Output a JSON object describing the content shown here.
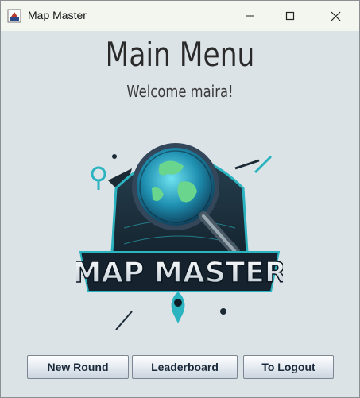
{
  "window": {
    "title": "Map Master",
    "icon": "java-app-icon",
    "controls": [
      "minimize-icon",
      "maximize-icon",
      "close-icon"
    ]
  },
  "main": {
    "heading": "Main Menu",
    "welcome": "Welcome maira!"
  },
  "logo": {
    "text": "MAP MASTER",
    "icon": "globe-magnifier-logo"
  },
  "buttons": {
    "new_round": "New Round",
    "leaderboard": "Leaderboard",
    "logout": "To Logout"
  },
  "colors": {
    "background": "#dce3e7",
    "titlebar": "#f3f5ef",
    "logo_teal": "#2bb3c0",
    "logo_dark": "#1c2a36"
  }
}
